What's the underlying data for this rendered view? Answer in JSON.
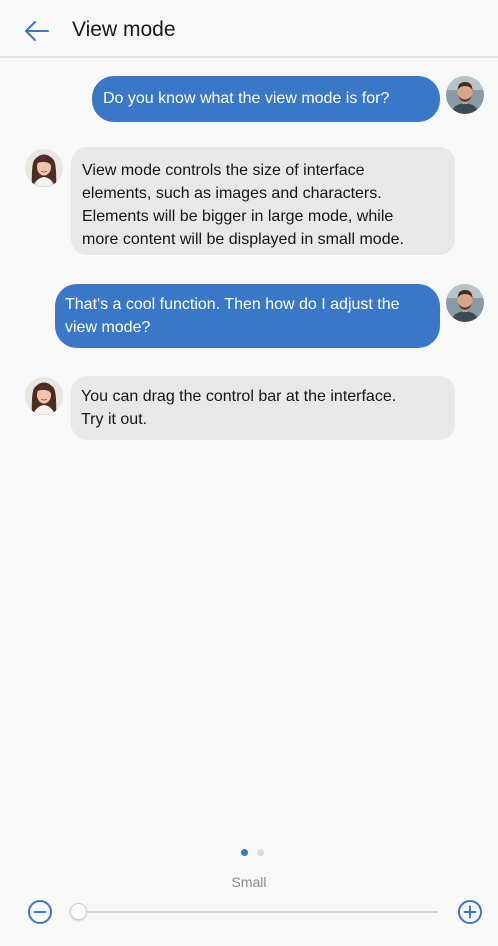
{
  "header": {
    "title": "View mode",
    "back_icon": "arrow-left-icon"
  },
  "messages": [
    {
      "from": "user",
      "lines": [
        "Do you know what the view mode is for?"
      ]
    },
    {
      "from": "assistant",
      "lines": [
        "View mode controls the size of interface",
        "elements, such as images and characters.",
        "Elements will be bigger in large mode, while",
        "more content will be displayed in small mode."
      ]
    },
    {
      "from": "user",
      "lines": [
        "That's a cool function. Then how do I adjust the",
        "view mode?"
      ]
    },
    {
      "from": "assistant",
      "lines": [
        "You can drag the control bar at the interface.",
        "Try it out."
      ]
    }
  ],
  "page_indicator": {
    "total": 2,
    "active": 1
  },
  "view_mode": {
    "level_label": "Small",
    "level_fraction": 0,
    "decrease_icon": "minus-circle-icon",
    "increase_icon": "plus-circle-icon"
  },
  "colors": {
    "accent": "#3a78c7",
    "incoming_bubble": "#e8e8e8",
    "background": "#f8f8f8"
  }
}
